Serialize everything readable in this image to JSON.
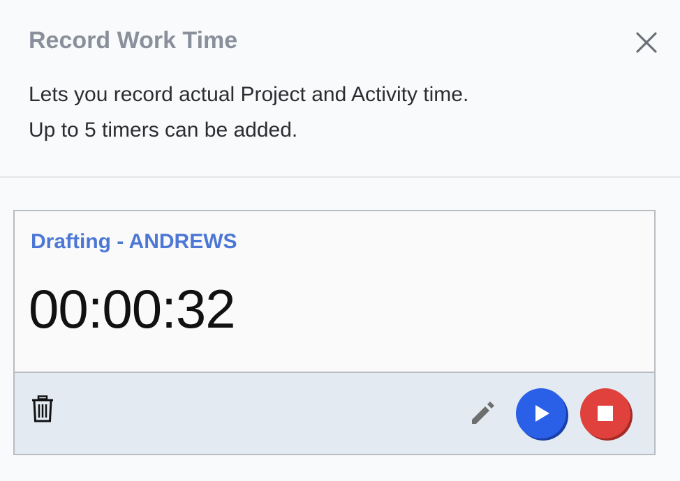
{
  "dialog": {
    "title": "Record Work Time",
    "description_lines": [
      "Lets you record actual Project and Activity time.",
      "Up to 5 timers can be added."
    ],
    "close_icon": "close-icon"
  },
  "timer": {
    "label": "Drafting - ANDREWS",
    "elapsed": "00:00:32",
    "actions": {
      "delete_icon": "trash-icon",
      "edit_icon": "pencil-icon",
      "play_icon": "play-icon",
      "stop_icon": "stop-icon"
    }
  },
  "colors": {
    "title": "#8a909b",
    "label": "#4c77d4",
    "play": "#2a5fe8",
    "stop": "#e0413d",
    "footer_bg": "#e3eaf2"
  }
}
